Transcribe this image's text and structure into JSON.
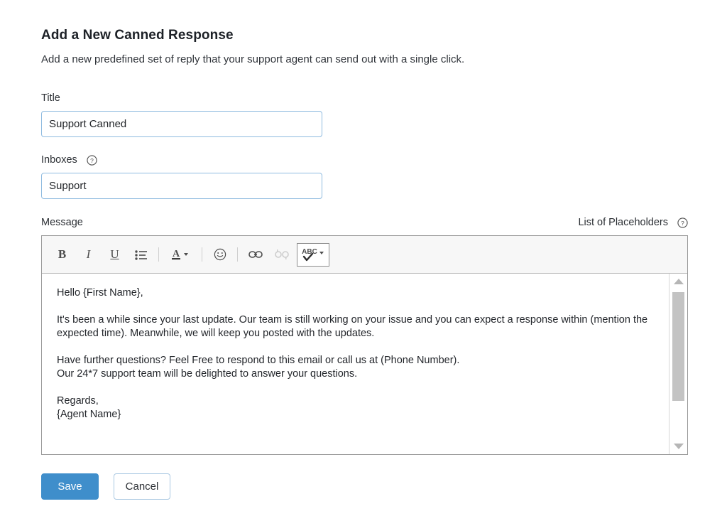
{
  "page": {
    "title": "Add a New Canned Response",
    "subtitle": "Add a new predefined set of reply that your support agent can send out with a single click."
  },
  "form": {
    "title_field": {
      "label": "Title",
      "value": "Support Canned",
      "placeholder": ""
    },
    "inboxes_field": {
      "label": "Inboxes",
      "value": "Support",
      "placeholder": "",
      "help_icon": "question-circle-icon"
    },
    "message_field": {
      "label": "Message",
      "placeholders_link": "List of Placeholders",
      "help_icon": "question-circle-icon"
    }
  },
  "toolbar": {
    "buttons": [
      {
        "name": "bold",
        "label": "B",
        "icon": "bold-icon",
        "disabled": false
      },
      {
        "name": "italic",
        "label": "I",
        "icon": "italic-icon",
        "disabled": false
      },
      {
        "name": "underline",
        "label": "U",
        "icon": "underline-icon",
        "disabled": false
      },
      {
        "name": "bullet-list",
        "label": "",
        "icon": "bullet-list-icon",
        "disabled": false
      },
      {
        "name": "font-color",
        "label": "A",
        "icon": "font-color-icon",
        "disabled": false
      },
      {
        "name": "emoji",
        "label": "",
        "icon": "emoji-icon",
        "disabled": false
      },
      {
        "name": "insert-link",
        "label": "",
        "icon": "link-icon",
        "disabled": false
      },
      {
        "name": "remove-link",
        "label": "",
        "icon": "unlink-icon",
        "disabled": true
      },
      {
        "name": "spell-check",
        "label": "ABC",
        "icon": "spellcheck-icon",
        "disabled": false
      }
    ]
  },
  "message_body": {
    "paragraphs": [
      "Hello {First Name},",
      "It's been a while since your last update. Our team is still working on your issue and you can expect a response within (mention the expected time). Meanwhile, we will keep you posted with the updates.",
      "Have further questions? Feel Free to respond to this email or call us at (Phone Number).",
      "Our 24*7 support team will be delighted to answer your questions.",
      "Regards,",
      "{Agent Name}"
    ]
  },
  "actions": {
    "save_label": "Save",
    "cancel_label": "Cancel"
  },
  "colors": {
    "primary": "#3f8ecb",
    "input_border": "#8fbbe0",
    "cancel_border": "#a9c8e2",
    "toolbar_bg": "#f7f7f7",
    "editor_border": "#9a9a9a",
    "scrollbar_thumb": "#c3c3c3"
  }
}
